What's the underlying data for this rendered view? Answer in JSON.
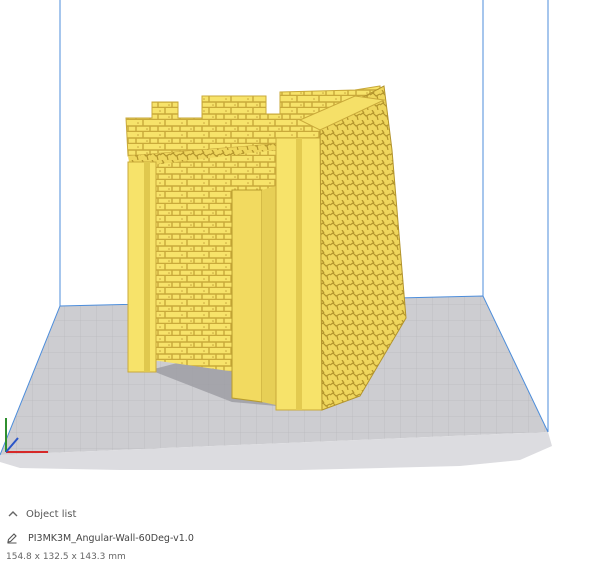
{
  "object_list": {
    "header_label": "Object list",
    "items": [
      {
        "name": "PI3MK3M_Angular-Wall-60Deg-v1.0"
      }
    ]
  },
  "selection": {
    "dimensions": "154.8 x 132.5 x 143.3 mm"
  },
  "colors": {
    "model": "#F7E36A",
    "model_shade": "#D9C24A",
    "model_dark": "#B89C2E",
    "build_plate": "#CDCDD1",
    "build_volume_line": "#4C8DDB",
    "shadow": "#9B9BA1"
  },
  "icons": {
    "collapse": "chevron-up-icon",
    "edit": "pencil-icon"
  }
}
